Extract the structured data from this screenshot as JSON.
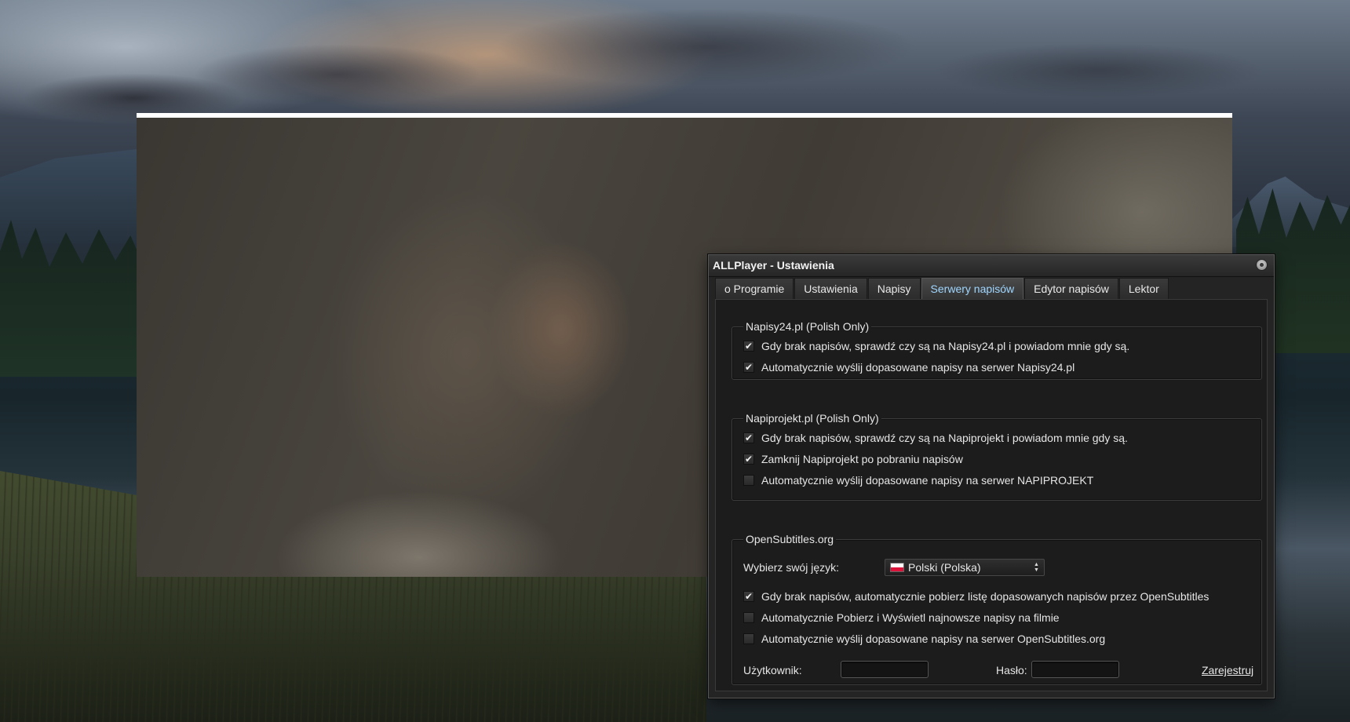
{
  "window": {
    "title": "ALLPlayer - Ustawienia"
  },
  "tabs": [
    {
      "label": "o Programie"
    },
    {
      "label": "Ustawienia"
    },
    {
      "label": "Napisy"
    },
    {
      "label": "Serwery napisów",
      "active": true
    },
    {
      "label": "Edytor napisów"
    },
    {
      "label": "Lektor"
    }
  ],
  "napisy24": {
    "legend": "Napisy24.pl (Polish Only)",
    "options": [
      {
        "label": "Gdy brak napisów, sprawdź czy są na Napisy24.pl i powiadom mnie gdy są.",
        "checked": true
      },
      {
        "label": "Automatycznie wyślij dopasowane napisy na serwer Napisy24.pl",
        "checked": true
      }
    ]
  },
  "napiprojekt": {
    "legend": "Napiprojekt.pl (Polish Only)",
    "options": [
      {
        "label": "Gdy brak napisów, sprawdź czy są na Napiprojekt i powiadom mnie gdy są.",
        "checked": true
      },
      {
        "label": "Zamknij Napiprojekt po pobraniu napisów",
        "checked": true
      },
      {
        "label": "Automatycznie wyślij dopasowane napisy na serwer NAPIPROJEKT",
        "checked": false
      }
    ]
  },
  "opensubtitles": {
    "legend": "OpenSubtitles.org",
    "language_label": "Wybierz swój język:",
    "language_value": "Polski (Polska)",
    "options": [
      {
        "label": "Gdy brak napisów, automatycznie pobierz listę dopasowanych napisów przez OpenSubtitles",
        "checked": true
      },
      {
        "label": "Automatycznie Pobierz i Wyświetl najnowsze napisy na filmie",
        "checked": false
      },
      {
        "label": "Automatycznie wyślij dopasowane napisy na serwer OpenSubtitles.org",
        "checked": false
      }
    ],
    "user_label": "Użytkownik:",
    "user_value": "",
    "password_label": "Hasło:",
    "password_value": "",
    "register_link": "Zarejestruj"
  },
  "glyphs": {
    "check": "✔",
    "spin": "▲▼"
  },
  "icons": {
    "close": "close-icon",
    "flag": "poland-flag-icon",
    "spin": "spin-arrows-icon"
  },
  "colors": {
    "active_tab": "#9fd6ff",
    "dialog_bg": "#242424",
    "panel_bg": "#1c1c1c"
  }
}
